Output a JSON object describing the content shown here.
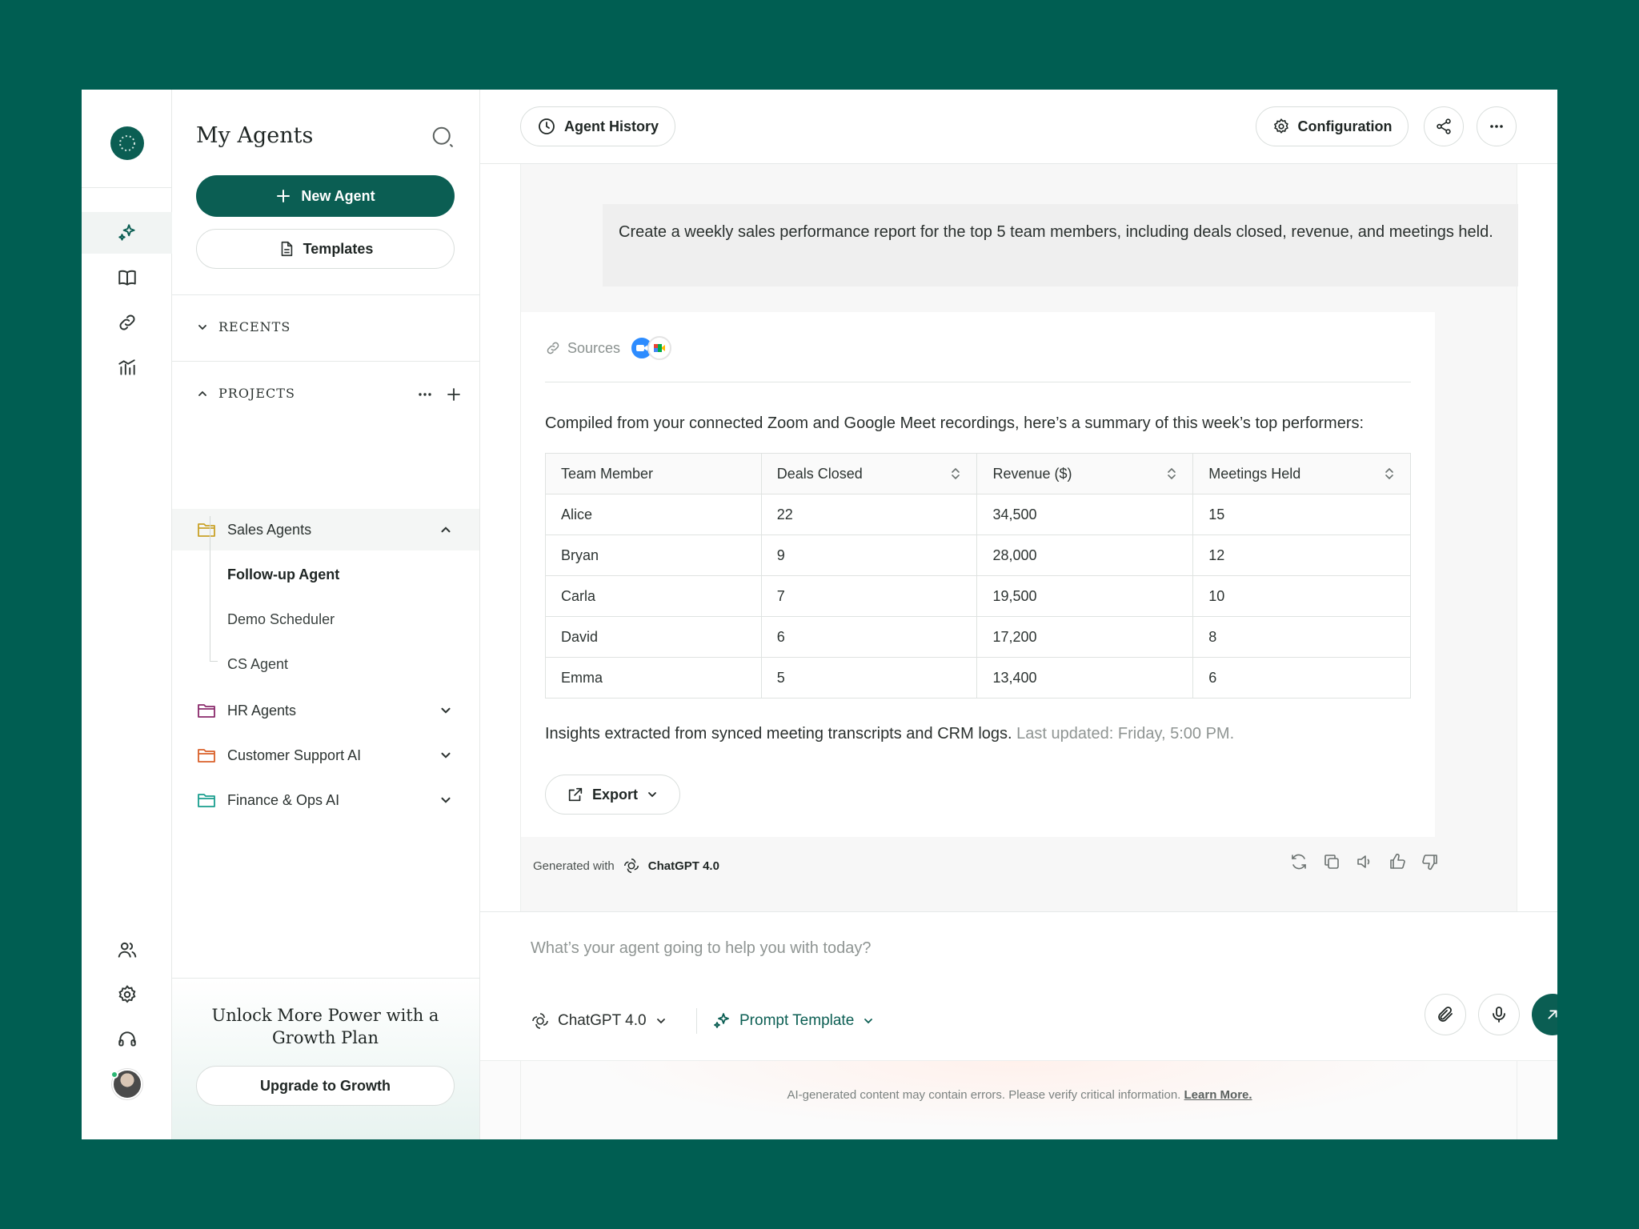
{
  "sidebar": {
    "title": "My Agents",
    "new_agent_label": "New Agent",
    "templates_label": "Templates",
    "recents_label": "RECENTS",
    "projects_label": "PROJECTS",
    "projects": [
      {
        "label": "Sales Agents",
        "color": "#c9a227",
        "expanded": true,
        "children": [
          "Follow-up Agent",
          "Demo Scheduler",
          "CS Agent"
        ]
      },
      {
        "label": "HR Agents",
        "color": "#8a2a6b",
        "expanded": false
      },
      {
        "label": "Customer Support AI",
        "color": "#d9602a",
        "expanded": false
      },
      {
        "label": "Finance & Ops AI",
        "color": "#1a9e8f",
        "expanded": false
      }
    ],
    "upgrade_title": "Unlock More Power with a Growth Plan",
    "upgrade_button": "Upgrade to Growth"
  },
  "header": {
    "agent_history_label": "Agent History",
    "configuration_label": "Configuration"
  },
  "chat": {
    "user_message": "Create a weekly sales performance report for the top 5 team members, including deals closed, revenue, and meetings held.",
    "sources_label": "Sources",
    "intro": "Compiled from your connected Zoom and Google Meet recordings, here’s a summary of this week’s top performers:",
    "table": {
      "headers": [
        "Team Member",
        "Deals Closed",
        "Revenue ($)",
        "Meetings Held"
      ],
      "rows": [
        [
          "Alice",
          "22",
          "34,500",
          "15"
        ],
        [
          "Bryan",
          "9",
          "28,000",
          "12"
        ],
        [
          "Carla",
          "7",
          "19,500",
          "10"
        ],
        [
          "David",
          "6",
          "17,200",
          "8"
        ],
        [
          "Emma",
          "5",
          "13,400",
          "6"
        ]
      ]
    },
    "footer_text": "Insights extracted from synced meeting transcripts and CRM logs.",
    "footer_muted": "Last updated: Friday, 5:00 PM.",
    "export_label": "Export",
    "generated_with_label": "Generated with",
    "generated_model": "ChatGPT 4.0"
  },
  "composer": {
    "placeholder": "What’s your agent going to help you with today?",
    "model_label": "ChatGPT 4.0",
    "prompt_template_label": "Prompt Template"
  },
  "disclaimer": {
    "text": "AI-generated content may contain errors. Please verify critical information.",
    "link": "Learn More."
  },
  "colors": {
    "brand": "#0b5e53",
    "background": "#005e52"
  }
}
